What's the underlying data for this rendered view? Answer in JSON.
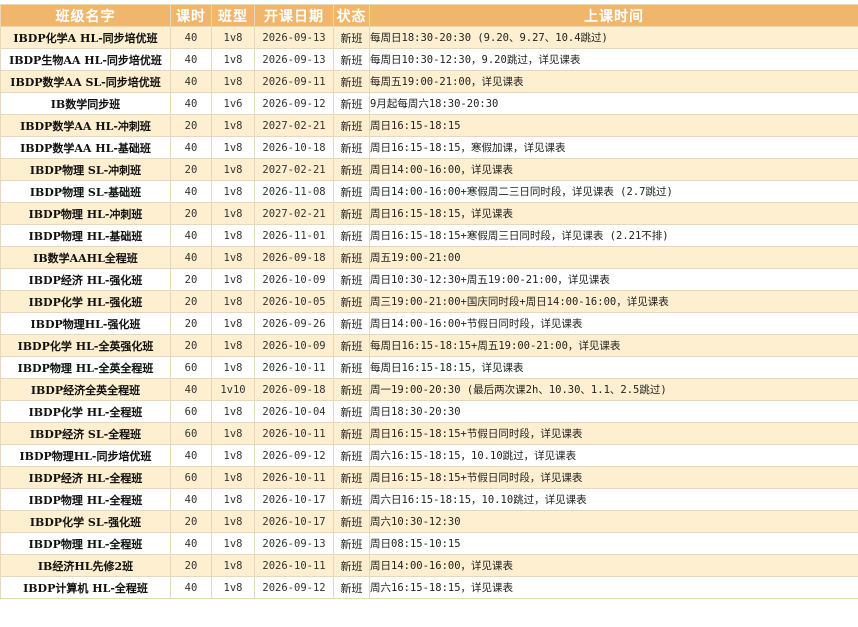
{
  "header": {
    "name": "班级名字",
    "hours": "课时",
    "type": "班型",
    "start_date": "开课日期",
    "status": "状态",
    "time": "上课时间"
  },
  "rows": [
    {
      "name": "IBDP化学A HL-同步培优班",
      "hours": "40",
      "type": "1v8",
      "date": "2026-09-13",
      "status": "新班",
      "time": "每周日18:30-20:30 (9.20、9.27、10.4跳过)"
    },
    {
      "name": "IBDP生物AA HL-同步培优班",
      "hours": "40",
      "type": "1v8",
      "date": "2026-09-13",
      "status": "新班",
      "time": "每周日10:30-12:30，9.20跳过，详见课表"
    },
    {
      "name": "IBDP数学AA SL-同步培优班",
      "hours": "40",
      "type": "1v8",
      "date": "2026-09-11",
      "status": "新班",
      "time": "每周五19:00-21:00，详见课表"
    },
    {
      "name": "IB数学同步班",
      "hours": "40",
      "type": "1v6",
      "date": "2026-09-12",
      "status": "新班",
      "time": "9月起每周六18:30-20:30"
    },
    {
      "name": "IBDP数学AA HL-冲刺班",
      "hours": "20",
      "type": "1v8",
      "date": "2027-02-21",
      "status": "新班",
      "time": "周日16:15-18:15"
    },
    {
      "name": "IBDP数学AA HL-基础班",
      "hours": "40",
      "type": "1v8",
      "date": "2026-10-18",
      "status": "新班",
      "time": "周日16:15-18:15，寒假加课，详见课表"
    },
    {
      "name": "IBDP物理 SL-冲刺班",
      "hours": "20",
      "type": "1v8",
      "date": "2027-02-21",
      "status": "新班",
      "time": "周日14:00-16:00，详见课表"
    },
    {
      "name": "IBDP物理 SL-基础班",
      "hours": "40",
      "type": "1v8",
      "date": "2026-11-08",
      "status": "新班",
      "time": "周日14:00-16:00+寒假周二三日同时段，详见课表 (2.7跳过)"
    },
    {
      "name": "IBDP物理 HL-冲刺班",
      "hours": "20",
      "type": "1v8",
      "date": "2027-02-21",
      "status": "新班",
      "time": "周日16:15-18:15，详见课表"
    },
    {
      "name": "IBDP物理 HL-基础班",
      "hours": "40",
      "type": "1v8",
      "date": "2026-11-01",
      "status": "新班",
      "time": "周日16:15-18:15+寒假周三日同时段，详见课表 (2.21不排)"
    },
    {
      "name": "IB数学AAHL全程班",
      "hours": "40",
      "type": "1v8",
      "date": "2026-09-18",
      "status": "新班",
      "time": "周五19:00-21:00"
    },
    {
      "name": "IBDP经济 HL-强化班",
      "hours": "20",
      "type": "1v8",
      "date": "2026-10-09",
      "status": "新班",
      "time": "周日10:30-12:30+周五19:00-21:00，详见课表"
    },
    {
      "name": "IBDP化学 HL-强化班",
      "hours": "20",
      "type": "1v8",
      "date": "2026-10-05",
      "status": "新班",
      "time": "周三19:00-21:00+国庆同时段+周日14:00-16:00，详见课表"
    },
    {
      "name": "IBDP物理HL-强化班",
      "hours": "20",
      "type": "1v8",
      "date": "2026-09-26",
      "status": "新班",
      "time": "周日14:00-16:00+节假日同时段，详见课表"
    },
    {
      "name": "IBDP化学 HL-全英强化班",
      "hours": "20",
      "type": "1v8",
      "date": "2026-10-09",
      "status": "新班",
      "time": "每周日16:15-18:15+周五19:00-21:00，详见课表"
    },
    {
      "name": "IBDP物理 HL-全英全程班",
      "hours": "60",
      "type": "1v8",
      "date": "2026-10-11",
      "status": "新班",
      "time": "每周日16:15-18:15，详见课表"
    },
    {
      "name": "IBDP经济全英全程班",
      "hours": "40",
      "type": "1v10",
      "date": "2026-09-18",
      "status": "新班",
      "time": "周一19:00-20:30 (最后两次课2h、10.30、1.1、2.5跳过)"
    },
    {
      "name": "IBDP化学 HL-全程班",
      "hours": "60",
      "type": "1v8",
      "date": "2026-10-04",
      "status": "新班",
      "time": "周日18:30-20:30"
    },
    {
      "name": "IBDP经济 SL-全程班",
      "hours": "60",
      "type": "1v8",
      "date": "2026-10-11",
      "status": "新班",
      "time": "周日16:15-18:15+节假日同时段，详见课表"
    },
    {
      "name": "IBDP物理HL-同步培优班",
      "hours": "40",
      "type": "1v8",
      "date": "2026-09-12",
      "status": "新班",
      "time": "周六16:15-18:15，10.10跳过，详见课表"
    },
    {
      "name": "IBDP经济 HL-全程班",
      "hours": "60",
      "type": "1v8",
      "date": "2026-10-11",
      "status": "新班",
      "time": "周日16:15-18:15+节假日同时段，详见课表"
    },
    {
      "name": "IBDP物理 HL-全程班",
      "hours": "40",
      "type": "1v8",
      "date": "2026-10-17",
      "status": "新班",
      "time": "周六日16:15-18:15，10.10跳过，详见课表"
    },
    {
      "name": "IBDP化学 SL-强化班",
      "hours": "20",
      "type": "1v8",
      "date": "2026-10-17",
      "status": "新班",
      "time": "周六10:30-12:30"
    },
    {
      "name": "IBDP物理 HL-全程班",
      "hours": "40",
      "type": "1v8",
      "date": "2026-09-13",
      "status": "新班",
      "time": "周日08:15-10:15"
    },
    {
      "name": "IB经济HL先修2班",
      "hours": "20",
      "type": "1v8",
      "date": "2026-10-11",
      "status": "新班",
      "time": "周日14:00-16:00，详见课表"
    },
    {
      "name": "IBDP计算机 HL-全程班",
      "hours": "40",
      "type": "1v8",
      "date": "2026-09-12",
      "status": "新班",
      "time": "周六16:15-18:15，详见课表"
    }
  ]
}
